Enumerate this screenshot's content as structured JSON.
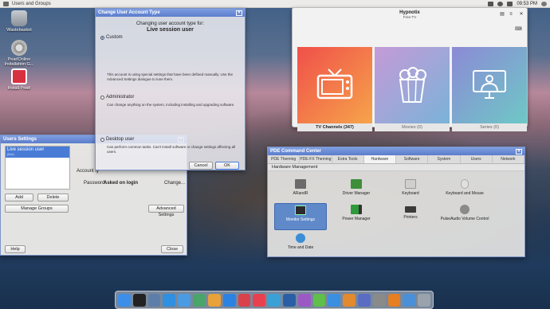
{
  "top_panel": {
    "app_name": "Users and Groups",
    "clock": "09:53 PM"
  },
  "desktop_icons": [
    {
      "label": "Wastebasket"
    },
    {
      "label": "PearlOnline Installation G..."
    },
    {
      "label": "Install Pearl"
    }
  ],
  "change_dialog": {
    "title": "Change User Account Type",
    "heading": "Changing user account type for:",
    "user": "Live session user",
    "options": [
      {
        "label": "Custom",
        "selected": true,
        "description": "This account is using special settings that have been defined manually. Use the Advanced Settings dialogue to tune them."
      },
      {
        "label": "Administrator",
        "selected": false,
        "description": "Can change anything on the system, including installing and upgrading software."
      },
      {
        "label": "Desktop user",
        "selected": false,
        "description": "Can perform common tasks. Can't install software or change settings affecting all users."
      }
    ],
    "cancel_label": "Cancel",
    "ok_label": "OK"
  },
  "hypnotix": {
    "title": "Hypnotix",
    "subtitle": "Free-TV",
    "cards": [
      {
        "label": "TV Channels (347)",
        "color_from": "#f0504a",
        "color_to": "#f6a44a"
      },
      {
        "label": "Movies (0)",
        "color_from": "#c59ad8",
        "color_to": "#7ab3d8"
      },
      {
        "label": "Series (0)",
        "color_from": "#8c8ad6",
        "color_to": "#6ec8c6"
      }
    ]
  },
  "users_settings": {
    "title": "Users Settings",
    "selected_user": "Live session user",
    "selected_user_sub": "(live)",
    "account_label": "Account ty",
    "password_label": "Password:",
    "password_value": "Asked on login",
    "change_link": "Change...",
    "add_label": "Add",
    "delete_label": "Delete",
    "manage_groups_label": "Manage Groups",
    "advanced_label": "Advanced Settings",
    "help_label": "Help",
    "close_label": "Close"
  },
  "pde": {
    "title": "PDE Command Center",
    "tabs": [
      "PDE Theming",
      "PDE-FX Theming",
      "Extra Tools",
      "Hardware",
      "Software",
      "System",
      "Users",
      "Network"
    ],
    "active_tab": "Hardware",
    "section": "Hardware Management",
    "tools": [
      {
        "label": "ARandR",
        "color": "#6b6b6b"
      },
      {
        "label": "Driver Manager",
        "color": "#3e8e3a"
      },
      {
        "label": "Keyboard",
        "color": "#cfcfcf"
      },
      {
        "label": "Keyboard and Mouse",
        "color": "#dcdcdc"
      },
      {
        "label": "Monitor Settings",
        "color": "#2b2b2b",
        "selected": true
      },
      {
        "label": "Power Manager",
        "color": "#2f9a3a"
      },
      {
        "label": "Printers",
        "color": "#3a3a3a"
      },
      {
        "label": "PulseAudio Volume Control",
        "color": "#8a8a8a"
      },
      {
        "label": "Time and Date",
        "color": "#3a8ed6"
      }
    ]
  },
  "dock": {
    "items": [
      {
        "name": "finder",
        "color": "#3d8ee8"
      },
      {
        "name": "terminal",
        "color": "#222222"
      },
      {
        "name": "launchpad",
        "color": "#5d7ea8"
      },
      {
        "name": "safari",
        "color": "#2f8fe0"
      },
      {
        "name": "mail",
        "color": "#4b9be2"
      },
      {
        "name": "maps",
        "color": "#49a56a"
      },
      {
        "name": "photos",
        "color": "#e8a13b"
      },
      {
        "name": "app-store",
        "color": "#2b82e3"
      },
      {
        "name": "pocket",
        "color": "#d9414b"
      },
      {
        "name": "music",
        "color": "#e9404f"
      },
      {
        "name": "camera",
        "color": "#3aa0d6"
      },
      {
        "name": "k-app",
        "color": "#2a5fa8"
      },
      {
        "name": "audio",
        "color": "#9b59c6"
      },
      {
        "name": "media",
        "color": "#5fbf4a"
      },
      {
        "name": "app-store-2",
        "color": "#3a8fe0"
      },
      {
        "name": "books",
        "color": "#e38a2e"
      },
      {
        "name": "apps",
        "color": "#5a6dc2"
      },
      {
        "name": "settings",
        "color": "#8a8a8a"
      },
      {
        "name": "vlc",
        "color": "#e67e22"
      },
      {
        "name": "folder",
        "color": "#4a90d9"
      },
      {
        "name": "trash",
        "color": "#9aa3ad"
      }
    ]
  }
}
